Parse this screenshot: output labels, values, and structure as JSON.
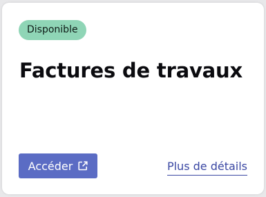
{
  "card": {
    "badge": "Disponible",
    "title": "Factures de travaux",
    "access_button": {
      "label": "Accéder",
      "icon": "external-link-icon"
    },
    "details_link": "Plus de détails"
  },
  "colors": {
    "badge_bg": "#8fd5b6",
    "button_bg": "#5b6cc4",
    "link": "#3a47a3"
  }
}
